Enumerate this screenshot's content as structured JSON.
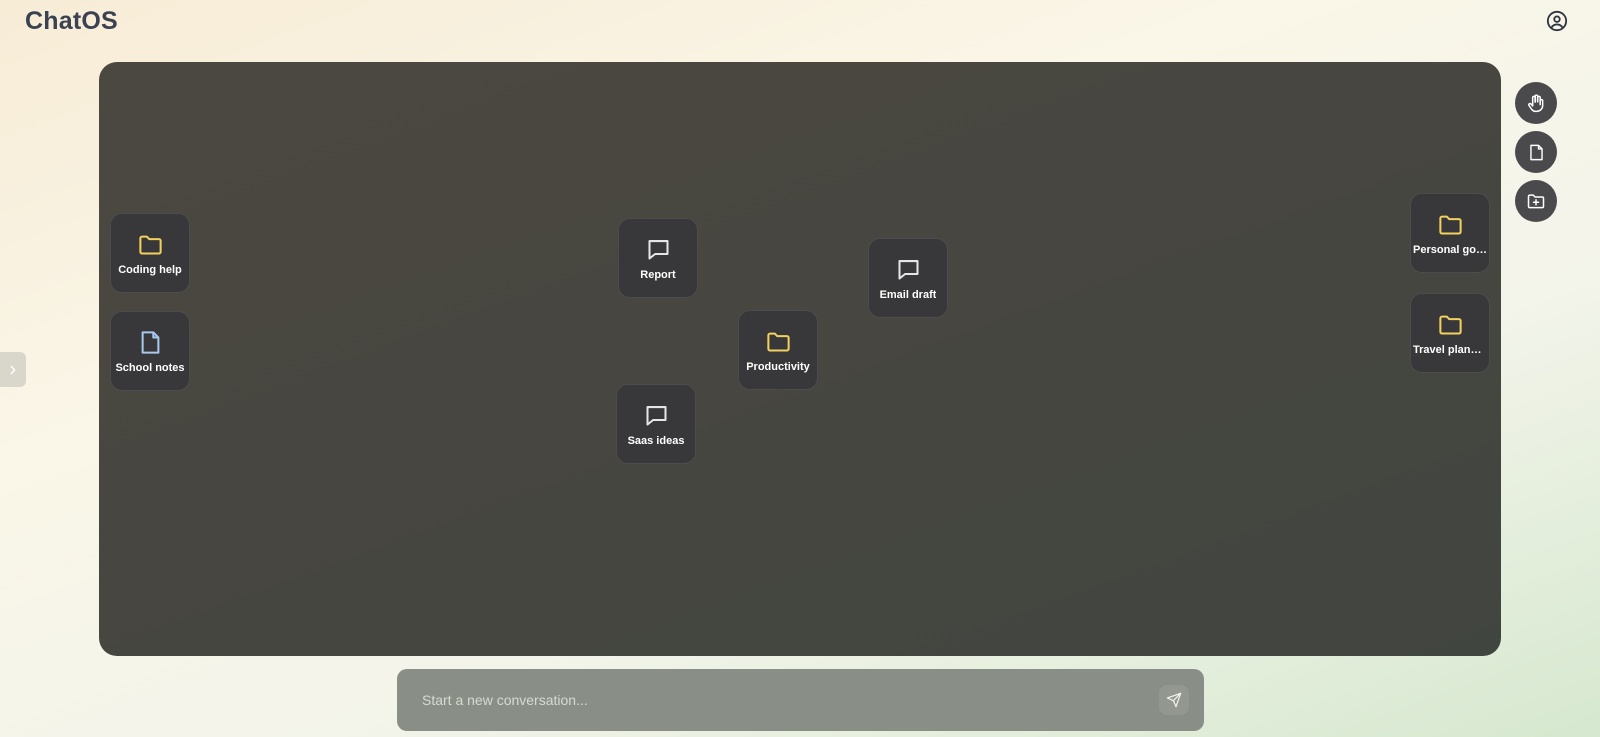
{
  "header": {
    "title": "ChatOS",
    "profile_icon": "user-circle-icon"
  },
  "sidebar": {
    "toggle_icon": "chevron-right-icon"
  },
  "colors": {
    "folder": "#f2d15e",
    "note": "#a9c8f0",
    "chat": "#e6e6e6",
    "tile_bg": "#38383a"
  },
  "canvas": {
    "items": [
      {
        "id": "coding-help",
        "type": "folder",
        "label": "Coding help"
      },
      {
        "id": "school-notes",
        "type": "note",
        "label": "School notes"
      },
      {
        "id": "report",
        "type": "chat",
        "label": "Report"
      },
      {
        "id": "productivity",
        "type": "folder",
        "label": "Productivity"
      },
      {
        "id": "saas-ideas",
        "type": "chat",
        "label": "Saas ideas"
      },
      {
        "id": "email-draft",
        "type": "chat",
        "label": "Email draft"
      },
      {
        "id": "personal-goals",
        "type": "folder",
        "label": "Personal goals"
      },
      {
        "id": "travel-planning",
        "type": "folder",
        "label": "Travel planning"
      }
    ]
  },
  "tools": [
    {
      "id": "pan",
      "icon": "hand-icon"
    },
    {
      "id": "new-note",
      "icon": "file-icon"
    },
    {
      "id": "new-folder",
      "icon": "folder-plus-icon"
    }
  ],
  "composer": {
    "placeholder": "Start a new conversation...",
    "send_icon": "send-icon"
  }
}
